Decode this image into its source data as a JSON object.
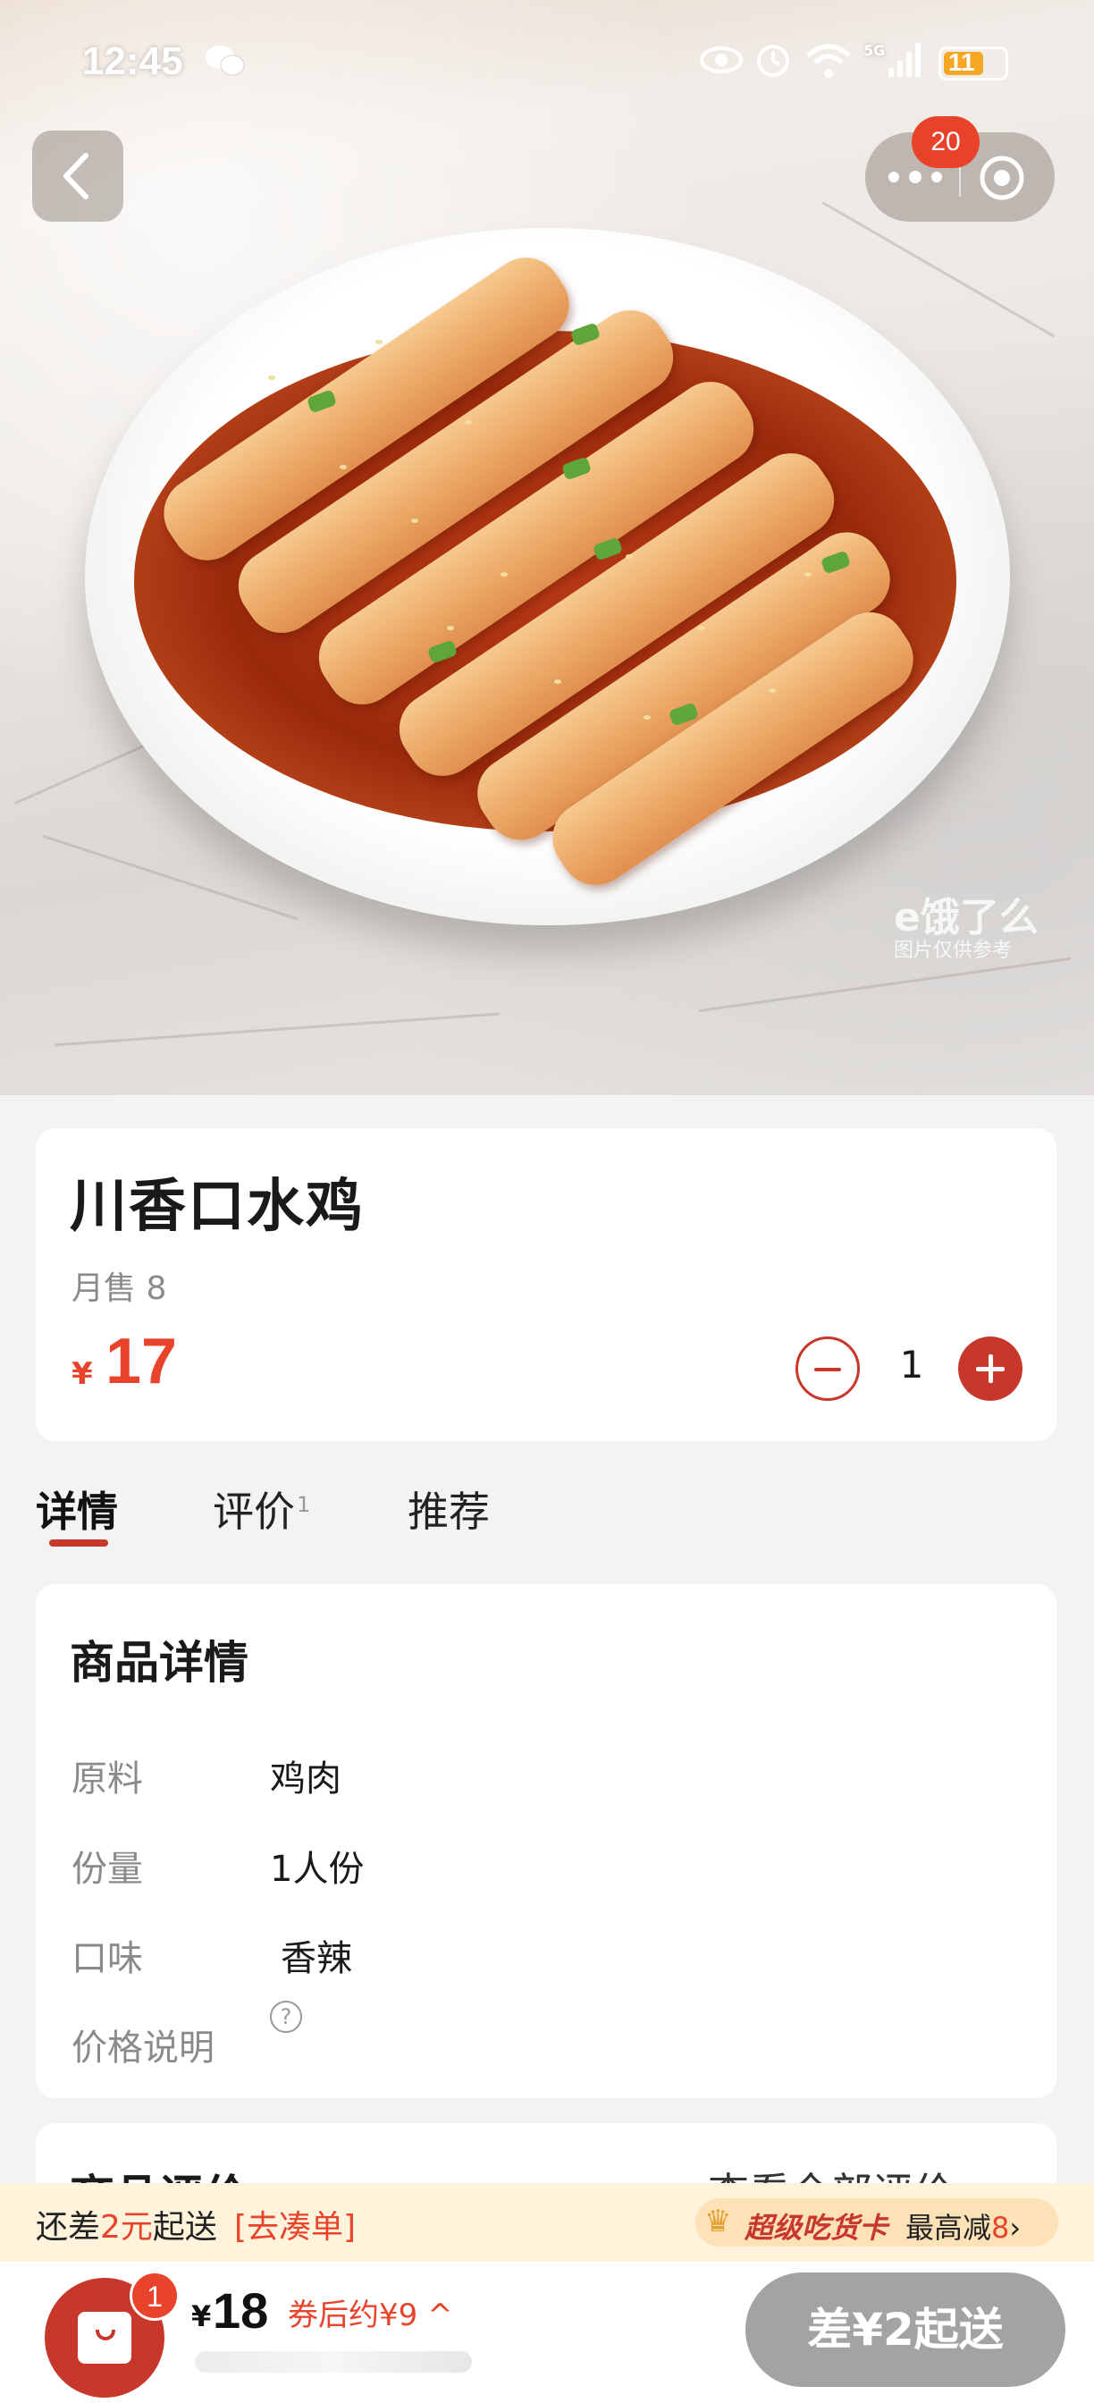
{
  "status_bar": {
    "time": "12:45",
    "battery": "11"
  },
  "top_bar": {
    "notification_count": "20"
  },
  "watermark": {
    "brand": "e饿了么",
    "note": "图片仅供参考"
  },
  "product": {
    "name": "川香口水鸡",
    "monthly_sales": "月售 8",
    "currency": "¥",
    "price": "17",
    "quantity": "1"
  },
  "tabs": [
    {
      "label": "详情"
    },
    {
      "label": "评价",
      "count": "1"
    },
    {
      "label": "推荐"
    }
  ],
  "details": {
    "title": "商品详情",
    "rows": [
      {
        "label": "原料",
        "value": "鸡肉"
      },
      {
        "label": "份量",
        "value": "1人份"
      },
      {
        "label": "口味",
        "value": "香辣"
      },
      {
        "label": "价格说明",
        "value": ""
      }
    ],
    "help_glyph": "?"
  },
  "reviews": {
    "title": "商品评价",
    "view_all": "查看全部评价"
  },
  "promo": {
    "prefix": "还差",
    "amount": "2元",
    "suffix": "起送",
    "link": "[去凑单]",
    "vip_label": "超级吃货卡",
    "discount_text": "最高减",
    "discount_value": "8",
    "chevron": "›"
  },
  "cart": {
    "badge": "1",
    "currency": "¥",
    "total": "18",
    "coupon_text": "券后约¥9 ^"
  },
  "checkout": {
    "label": "差¥2起送"
  },
  "colors": {
    "accent": "#c8372b",
    "price_red": "#e8432b",
    "promo_bg": "#fff3dc",
    "checkout_disabled": "#a3a3a3"
  }
}
